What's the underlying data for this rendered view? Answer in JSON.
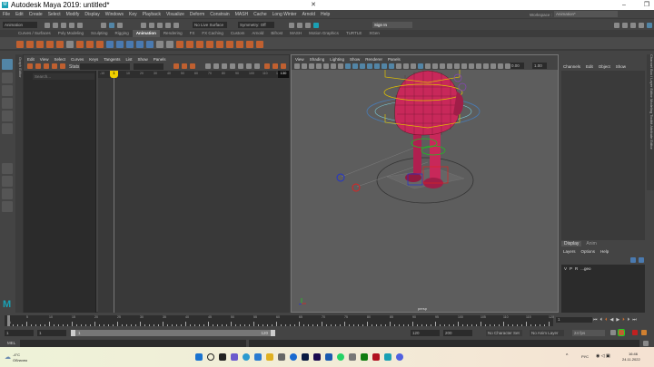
{
  "window": {
    "title": "Autodesk Maya 2019: untitled*",
    "minimize": "–",
    "restore": "❐",
    "close": "✕"
  },
  "menu": [
    "File",
    "Edit",
    "Create",
    "Select",
    "Modify",
    "Display",
    "Windows",
    "Key",
    "Playback",
    "Visualize",
    "Deform",
    "Constrain",
    "MASH",
    "Cache",
    "Long Winter",
    "Arnold",
    "Help"
  ],
  "status": {
    "menuset": "Animation",
    "live_surface": "No Live Surface",
    "symmetry": "Symmetry: Off",
    "sign_in": "Sign In",
    "workspace_label": "Workspace :",
    "workspace": "Animation*"
  },
  "shelf_tabs": [
    "Curves / Surfaces",
    "Poly Modeling",
    "Sculpting",
    "Rigging",
    "Animation",
    "Rendering",
    "FX",
    "FX Caching",
    "Custom",
    "Arnold",
    "Bifrost",
    "MASH",
    "Motion Graphics",
    "TURTLE",
    "XGen"
  ],
  "shelf_active": "Animation",
  "graph_editor": {
    "side_label": "Graph Editor",
    "menu": [
      "Edit",
      "View",
      "Select",
      "Curves",
      "Keys",
      "Tangents",
      "List",
      "Show",
      "Panels"
    ],
    "stats_label": "Stats",
    "search_placeholder": "Search...",
    "ruler": [
      "-10",
      "10",
      "20",
      "30",
      "40",
      "50",
      "60",
      "70",
      "80",
      "90",
      "100",
      "110",
      "120"
    ],
    "current_frame": "1",
    "end_marker": "130"
  },
  "viewport": {
    "menu": [
      "View",
      "Shading",
      "Lighting",
      "Show",
      "Renderer",
      "Panels"
    ],
    "exposure": "0.00",
    "gamma": "1.00",
    "camera": "persp"
  },
  "channel_box": {
    "menu": [
      "Channels",
      "Edit",
      "Object",
      "Show"
    ],
    "side_tabs": "Channel Box / Layer Editor   Modeling Toolkit   Attribute Editor"
  },
  "layers": {
    "tabs": [
      "Display",
      "Anim"
    ],
    "menu": [
      "Layers",
      "Options",
      "Help"
    ],
    "row": {
      "v": "V",
      "p": "P",
      "r": "R",
      "name": "...geo"
    }
  },
  "timeline": {
    "ticks": [
      "5",
      "10",
      "15",
      "20",
      "25",
      "30",
      "35",
      "40",
      "45",
      "50",
      "55",
      "60",
      "65",
      "70",
      "75",
      "80",
      "85",
      "90",
      "95",
      "100",
      "105",
      "110",
      "115",
      "120"
    ],
    "current": "1",
    "current_field": "1"
  },
  "range": {
    "start": "1",
    "playback_start": "1",
    "slider_start": "1",
    "slider_end": "120",
    "playback_end": "120",
    "end": "200",
    "character_set": "No Character Set",
    "anim_layer": "No Anim Layer",
    "fps": "24 fps"
  },
  "command": {
    "label": "MEL"
  },
  "taskbar": {
    "weather_temp": "-4°C",
    "weather_text": "Облачно",
    "lang": "РУС",
    "time": "16:46",
    "date": "24.11.2022"
  },
  "colors": {
    "accent": "#5285a6",
    "mesh": "#c8285a",
    "active_tab": "#555555"
  }
}
